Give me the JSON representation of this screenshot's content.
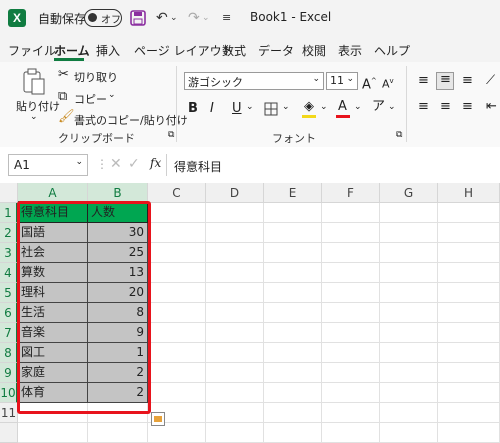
{
  "titlebar": {
    "logo_letter": "X",
    "autosave_label": "自動保存",
    "autosave_state": "オフ",
    "book_title": "Book1  -  Excel"
  },
  "tabs": [
    "ファイル",
    "ホーム",
    "挿入",
    "ページ レイアウト",
    "数式",
    "データ",
    "校閲",
    "表示",
    "ヘルプ"
  ],
  "active_tab": "ホーム",
  "ribbon": {
    "clipboard": {
      "paste": "貼り付け",
      "cut": "切り取り",
      "copy": "コピー",
      "format_painter": "書式のコピー/貼り付け",
      "label": "クリップボード"
    },
    "font": {
      "font_name": "游ゴシック",
      "font_size": "11",
      "label": "フォント",
      "bold": "B",
      "italic": "I",
      "underline": "U",
      "grow": "A",
      "shrink": "A"
    }
  },
  "formula_bar": {
    "name_box": "A1",
    "fx": "fx",
    "content": "得意科目"
  },
  "columns": [
    "A",
    "B",
    "C",
    "D",
    "E",
    "F",
    "G",
    "H"
  ],
  "rows": [
    "1",
    "2",
    "3",
    "4",
    "5",
    "6",
    "7",
    "8",
    "9",
    "10",
    "11"
  ],
  "table": {
    "header": [
      "得意科目",
      "人数"
    ],
    "rows": [
      [
        "国語",
        "30"
      ],
      [
        "社会",
        "25"
      ],
      [
        "算数",
        "13"
      ],
      [
        "理科",
        "20"
      ],
      [
        "生活",
        "8"
      ],
      [
        "音楽",
        "9"
      ],
      [
        "図工",
        "1"
      ],
      [
        "家庭",
        "2"
      ],
      [
        "体育",
        "2"
      ]
    ]
  },
  "colors": {
    "excel_green": "#107c41",
    "header_fill": "#00a651",
    "data_fill": "#c4c4c4",
    "highlight_border": "#e8131c"
  }
}
